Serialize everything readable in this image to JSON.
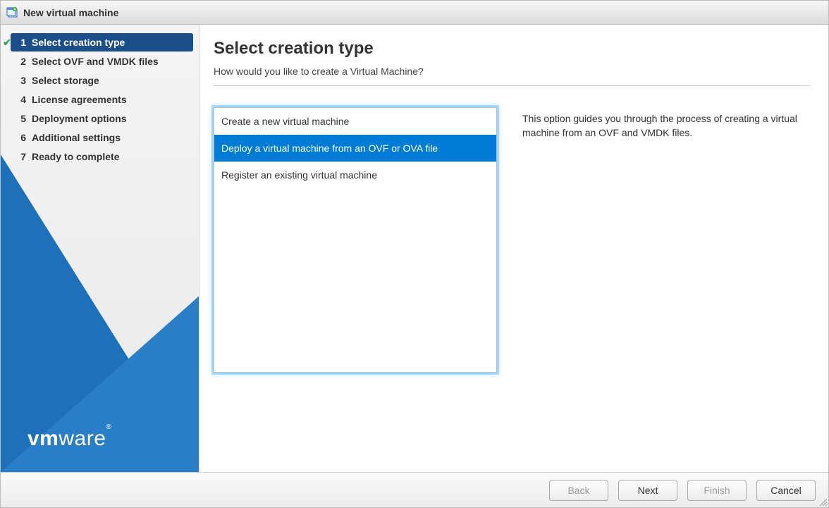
{
  "window": {
    "title": "New virtual machine"
  },
  "sidebar": {
    "steps": [
      {
        "num": "1",
        "label": "Select creation type"
      },
      {
        "num": "2",
        "label": "Select OVF and VMDK files"
      },
      {
        "num": "3",
        "label": "Select storage"
      },
      {
        "num": "4",
        "label": "License agreements"
      },
      {
        "num": "5",
        "label": "Deployment options"
      },
      {
        "num": "6",
        "label": "Additional settings"
      },
      {
        "num": "7",
        "label": "Ready to complete"
      }
    ],
    "activeIndex": 0,
    "logo_bold": "vm",
    "logo_light": "ware"
  },
  "main": {
    "heading": "Select creation type",
    "subheading": "How would you like to create a Virtual Machine?",
    "options": [
      "Create a new virtual machine",
      "Deploy a virtual machine from an OVF or OVA file",
      "Register an existing virtual machine"
    ],
    "selectedOption": 1,
    "description": "This option guides you through the process of creating a virtual machine from an OVF and VMDK files."
  },
  "footer": {
    "back": "Back",
    "next": "Next",
    "finish": "Finish",
    "cancel": "Cancel",
    "backEnabled": false,
    "nextEnabled": true,
    "finishEnabled": false,
    "cancelEnabled": true
  }
}
